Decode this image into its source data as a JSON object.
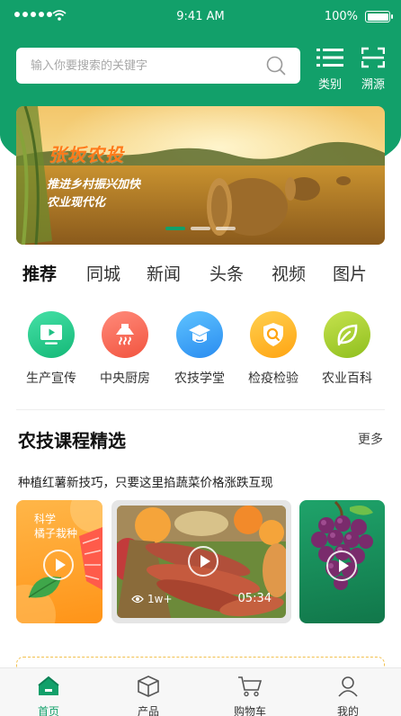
{
  "status_bar": {
    "time": "9:41 AM",
    "battery": "100%"
  },
  "search": {
    "placeholder": "输入你要搜索的关键字",
    "icon": "search-icon"
  },
  "top_actions": [
    {
      "label": "类别",
      "icon": "list-icon"
    },
    {
      "label": "溯源",
      "icon": "scan-icon"
    }
  ],
  "banner": {
    "title": "张坂农投",
    "lines": [
      "推进乡村振兴加快",
      "农业现代化"
    ],
    "pager": {
      "count": 3,
      "active": 0
    }
  },
  "tabs": [
    {
      "label": "推荐",
      "active": true
    },
    {
      "label": "同城"
    },
    {
      "label": "新闻"
    },
    {
      "label": "头条"
    },
    {
      "label": "视频"
    },
    {
      "label": "图片"
    }
  ],
  "categories": [
    {
      "label": "生产宣传",
      "icon": "tv-icon",
      "color": "#1fcc8c"
    },
    {
      "label": "中央厨房",
      "icon": "range-hood-icon",
      "color": "#ff6b5e"
    },
    {
      "label": "农技学堂",
      "icon": "graduation-cap-icon",
      "color": "#3aa8ff"
    },
    {
      "label": "检疫检验",
      "icon": "shield-search-icon",
      "color": "#ffb21c"
    },
    {
      "label": "农业百科",
      "icon": "leaf-icon",
      "color": "#a9cf2d"
    }
  ],
  "section": {
    "title": "农技课程精选",
    "more": "更多",
    "subtitle": "种植红薯新技巧，只要这里掐蔬菜价格涨跌互现"
  },
  "cards": [
    {
      "tag1": "科学",
      "tag2": "橘子栽种",
      "color": "#ffa22e"
    },
    {
      "views": "1w+",
      "duration": "05:34"
    },
    {
      "color": "#1a8f5c"
    }
  ],
  "tabbar": [
    {
      "label": "首页",
      "icon": "home-icon",
      "active": true
    },
    {
      "label": "产品",
      "icon": "box-icon"
    },
    {
      "label": "购物车",
      "icon": "cart-icon"
    },
    {
      "label": "我的",
      "icon": "user-icon"
    }
  ]
}
